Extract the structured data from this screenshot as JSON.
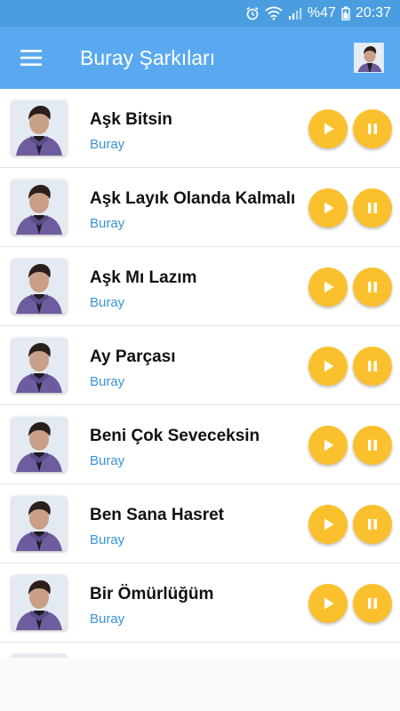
{
  "status_bar": {
    "icons": [
      "alarm-icon",
      "wifi-icon",
      "signal-icon",
      "battery-icon"
    ],
    "battery": "%47",
    "time": "20:37"
  },
  "app_bar": {
    "title": "Buray Şarkıları",
    "menu_icon": "hamburger-menu-icon"
  },
  "songs": [
    {
      "title": "Aşk Bitsin",
      "artist": "Buray"
    },
    {
      "title": "Aşk Layık Olanda Kalmalı",
      "artist": "Buray"
    },
    {
      "title": "Aşk Mı Lazım",
      "artist": "Buray"
    },
    {
      "title": "Ay Parçası",
      "artist": "Buray"
    },
    {
      "title": "Beni Çok Seveceksin",
      "artist": "Buray"
    },
    {
      "title": "Ben Sana Hasret",
      "artist": "Buray"
    },
    {
      "title": "Bir Ömürlüğüm",
      "artist": "Buray"
    },
    {
      "title": "",
      "artist": ""
    }
  ],
  "colors": {
    "status_bar": "#4a9ee0",
    "app_bar": "#5aa9f0",
    "button": "#fbc02d",
    "artist_text": "#3a93d6"
  }
}
